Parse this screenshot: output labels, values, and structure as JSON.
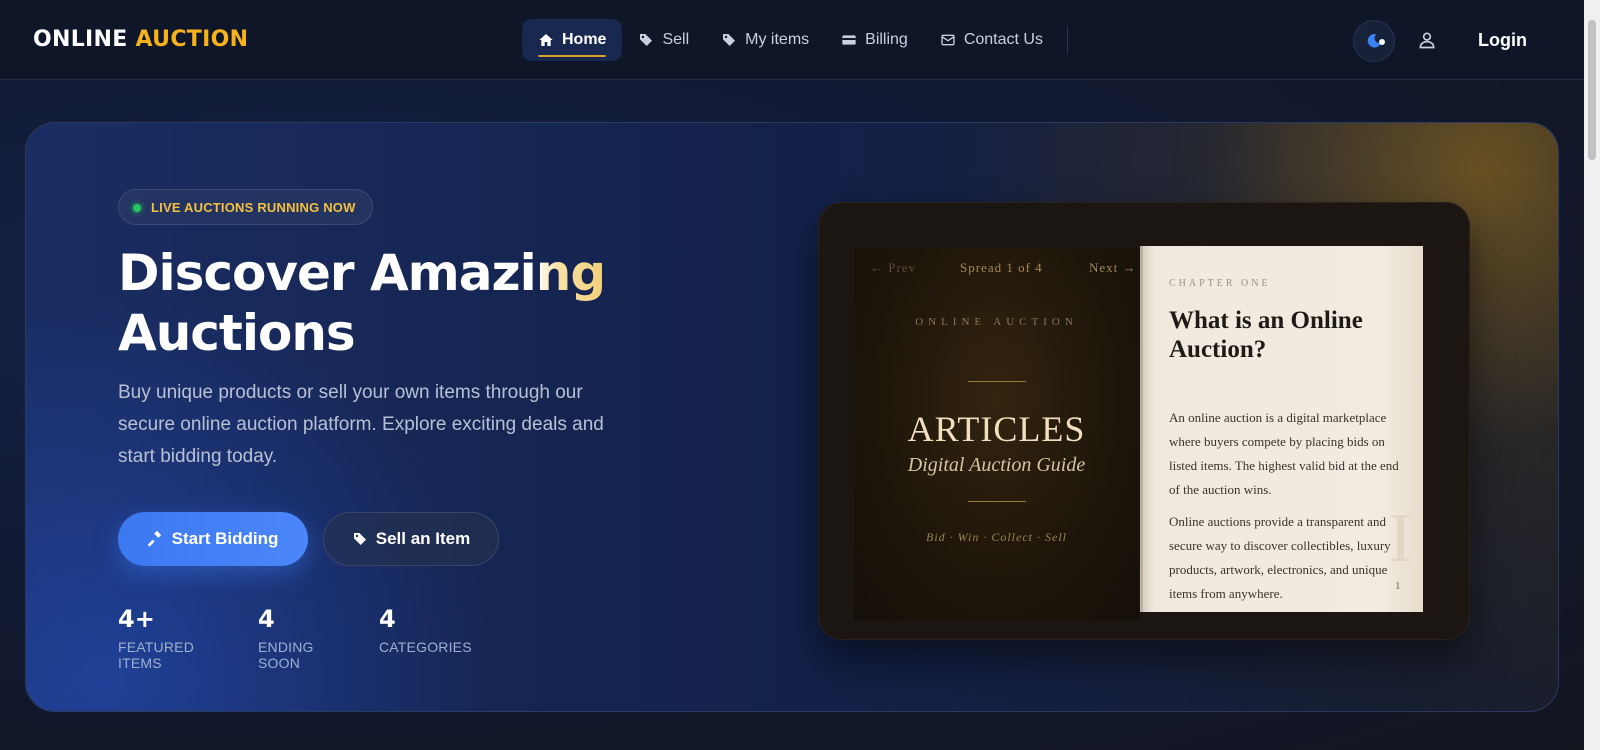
{
  "brand": {
    "word1": "ONLINE",
    "word2": "AUCTION"
  },
  "nav": {
    "items": [
      {
        "label": "Home",
        "icon": "home-icon",
        "active": true
      },
      {
        "label": "Sell",
        "icon": "tag-icon"
      },
      {
        "label": "My items",
        "icon": "tag-icon"
      },
      {
        "label": "Billing",
        "icon": "credit-card-icon"
      },
      {
        "label": "Contact Us",
        "icon": "mail-icon"
      }
    ],
    "theme_toggle_icon": "moon-icon",
    "user_icon": "user-icon",
    "login_label": "Login"
  },
  "hero": {
    "badge": "LIVE AUCTIONS RUNNING NOW",
    "title_part1": "Discover Amazi",
    "title_part2": "ng",
    "title_line2": "Auctions",
    "description": "Buy unique products or sell your own items through our secure online auction platform. Explore exciting deals and start bidding today.",
    "primary_button": "Start Bidding",
    "secondary_button": "Sell an Item",
    "stats": [
      {
        "value": "4+",
        "label": "FEATURED ITEMS"
      },
      {
        "value": "4",
        "label": "ENDING SOON"
      },
      {
        "value": "4",
        "label": "CATEGORIES"
      }
    ]
  },
  "book": {
    "prev": "← Prev",
    "spread": "Spread 1 of 4",
    "next": "Next →",
    "left_brand": "ONLINE AUCTION",
    "left_title": "ARTICLES",
    "left_subtitle": "Digital Auction Guide",
    "left_motto": "Bid · Win · Collect · Sell",
    "chapter": "CHAPTER ONE",
    "right_title": "What is an Online Auction?",
    "paragraph1": "An online auction is a digital marketplace where buyers compete by placing bids on listed items. The highest valid bid at the end of the auction wins.",
    "paragraph2": "Online auctions provide a transparent and secure way to discover collectibles, luxury products, artwork, electronics, and unique items from anywhere.",
    "drop_cap": "I",
    "page_number": "1"
  },
  "colors": {
    "accent_gold": "#f5b21d",
    "primary_blue": "#3c78f0",
    "live_green": "#22c55e"
  }
}
